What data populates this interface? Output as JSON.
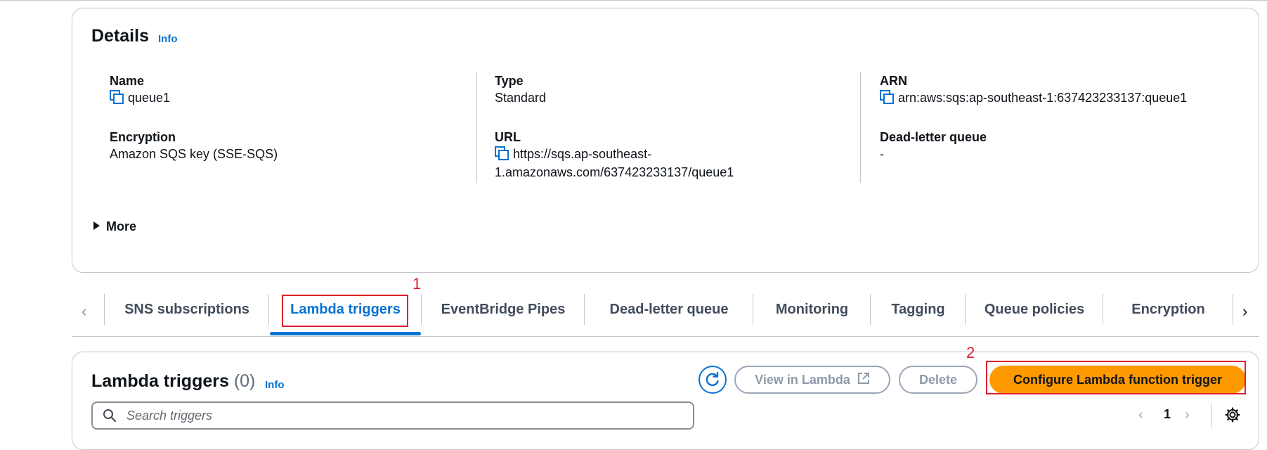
{
  "details": {
    "title": "Details",
    "info": "Info",
    "fields": {
      "name": {
        "label": "Name",
        "value": "queue1"
      },
      "type": {
        "label": "Type",
        "value": "Standard"
      },
      "arn": {
        "label": "ARN",
        "value": "arn:aws:sqs:ap-southeast-1:637423233137:queue1"
      },
      "encryption": {
        "label": "Encryption",
        "value": "Amazon SQS key (SSE-SQS)"
      },
      "url": {
        "label": "URL",
        "value_line1": "https://sqs.ap-southeast-",
        "value_line2": "1.amazonaws.com/637423233137/queue1"
      },
      "dlq": {
        "label": "Dead-letter queue",
        "value": "-"
      }
    },
    "more": "More"
  },
  "tabs": {
    "items": [
      "SNS subscriptions",
      "Lambda triggers",
      "EventBridge Pipes",
      "Dead-letter queue",
      "Monitoring",
      "Tagging",
      "Queue policies",
      "Encryption"
    ],
    "active_index": 1
  },
  "annotations": {
    "mark1": "1",
    "mark2": "2"
  },
  "triggers": {
    "title": "Lambda triggers",
    "count": "(0)",
    "info": "Info",
    "view_button": "View in Lambda",
    "delete_button": "Delete",
    "configure_button": "Configure Lambda function trigger",
    "search_placeholder": "Search triggers",
    "page": "1"
  },
  "colors": {
    "accent": "#0972d3",
    "primary_button": "#ff9900",
    "annotation": "#e0202e"
  }
}
